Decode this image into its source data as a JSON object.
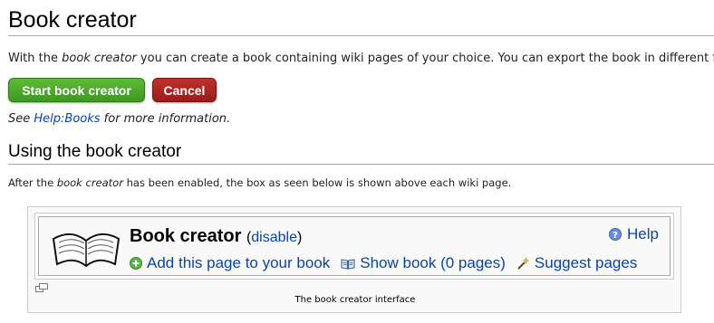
{
  "page": {
    "title": "Book creator",
    "intro_parts": {
      "before": "With the ",
      "emph": "book creator",
      "after": " you can create a book containing wiki pages of your choice. You can export the book in different formats"
    },
    "buttons": {
      "start": "Start book creator",
      "cancel": "Cancel"
    },
    "see_also": {
      "before": "See ",
      "link": "Help:Books",
      "after": " for more information."
    },
    "section": {
      "heading": "Using the book creator",
      "para_before": "After the ",
      "para_emph": "book creator",
      "para_after": " has been enabled, the box as seen below is shown above each wiki page."
    }
  },
  "figure": {
    "box_title": "Book creator",
    "disable_open": "(",
    "disable_link": "disable",
    "disable_close": ")",
    "help_label": "Help",
    "actions": [
      {
        "label": "Add this page to your book",
        "icon": "plus-circle-icon"
      },
      {
        "label": "Show book (0 pages)",
        "icon": "open-book-icon"
      },
      {
        "label": "Suggest pages",
        "icon": "magic-wand-icon"
      }
    ],
    "caption": "The book creator interface"
  },
  "colors": {
    "link": "#0645ad",
    "start_button": "#4aa82a",
    "cancel_button": "#aa2420"
  }
}
